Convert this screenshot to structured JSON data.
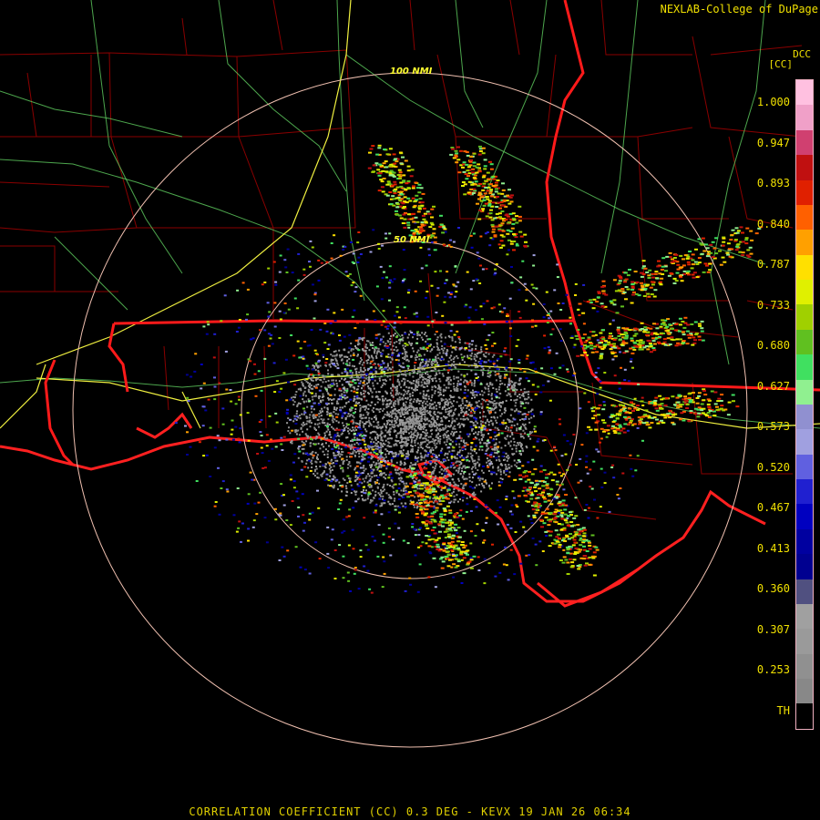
{
  "header": {
    "credit": "NEXLAB-College of DuPage",
    "product": "DCC",
    "unit": "[CC]"
  },
  "rings": {
    "inner_label": "50 NMI",
    "outer_label": "100 NMI"
  },
  "colorbar": {
    "ticks": [
      "1.000",
      "0.947",
      "0.893",
      "0.840",
      "0.787",
      "0.733",
      "0.680",
      "0.627",
      "0.573",
      "0.520",
      "0.467",
      "0.413",
      "0.360",
      "0.307",
      "0.253",
      "TH"
    ],
    "colors": [
      "#ffc0e0",
      "#f0a0c8",
      "#d04070",
      "#c01010",
      "#e02000",
      "#ff6000",
      "#ffa000",
      "#ffe000",
      "#e0f000",
      "#a0d000",
      "#60c020",
      "#40e060",
      "#90f090",
      "#9090d0",
      "#a0a0e0",
      "#6060e0",
      "#2020d0",
      "#0000c0",
      "#0000a0",
      "#000090",
      "#505080",
      "#a0a0a0",
      "#9a9a9a",
      "#909090",
      "#888888",
      "#000000"
    ]
  },
  "footer": {
    "caption": "CORRELATION COEFFICIENT (CC) 0.3 DEG - KEVX 19 JAN 26 06:34"
  }
}
